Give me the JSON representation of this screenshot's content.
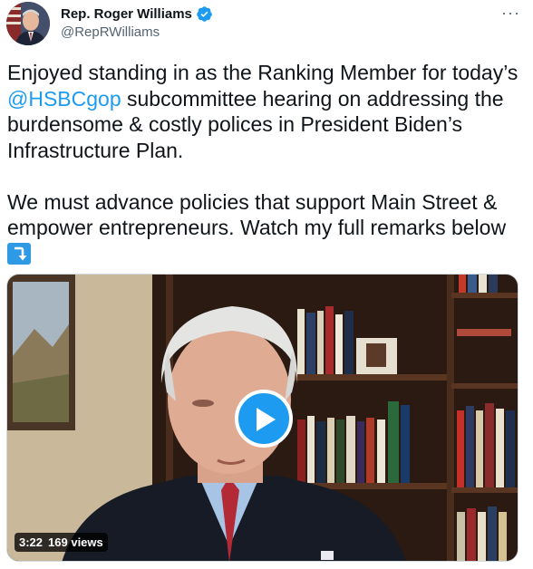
{
  "author": {
    "display_name": "Rep. Roger Williams",
    "handle": "@RepRWilliams",
    "verified": true
  },
  "more_menu_label": "···",
  "tweet": {
    "line1": "Enjoyed standing in as the Ranking Member for today’s",
    "mention": "@HSBCgop",
    "line2_rest": " subcommittee hearing on addressing the",
    "line3": "burdensome & costly polices in President Biden’s",
    "line4": "Infrastructure Plan.",
    "line5": "We must advance policies that support Main Street &",
    "line6": "empower entrepreneurs. Watch my full remarks below",
    "emoji": "arrow-curving-down-icon"
  },
  "video": {
    "duration": "3:22",
    "views": "169 views"
  },
  "colors": {
    "accent": "#1d9bf0",
    "text": "#0f1419",
    "secondary": "#536471"
  }
}
